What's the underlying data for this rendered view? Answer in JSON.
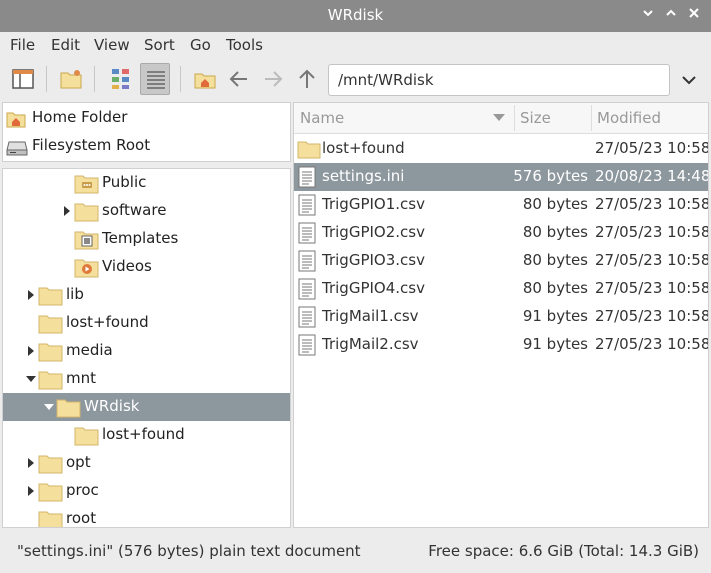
{
  "window": {
    "title": "WRdisk"
  },
  "menu": [
    "File",
    "Edit",
    "View",
    "Sort",
    "Go",
    "Tools"
  ],
  "toolbar": {
    "path": "/mnt/WRdisk"
  },
  "places": [
    {
      "label": "Home Folder",
      "icon": "home-icon"
    },
    {
      "label": "Filesystem Root",
      "icon": "drive-icon"
    }
  ],
  "tree": [
    {
      "label": "Public",
      "icon": "folder-public-icon",
      "expander": "none"
    },
    {
      "label": "software",
      "icon": "folder-icon",
      "expander": "collapsed"
    },
    {
      "label": "Templates",
      "icon": "folder-templates-icon",
      "expander": "none"
    },
    {
      "label": "Videos",
      "icon": "folder-videos-icon",
      "expander": "none"
    },
    {
      "label": "lib",
      "icon": "folder-icon",
      "expander": "collapsed"
    },
    {
      "label": "lost+found",
      "icon": "folder-icon",
      "expander": "none"
    },
    {
      "label": "media",
      "icon": "folder-icon",
      "expander": "collapsed"
    },
    {
      "label": "mnt",
      "icon": "folder-icon",
      "expander": "expanded"
    },
    {
      "label": "WRdisk",
      "icon": "folder-icon",
      "expander": "expanded",
      "selected": true
    },
    {
      "label": "lost+found",
      "icon": "folder-icon",
      "expander": "none"
    },
    {
      "label": "opt",
      "icon": "folder-icon",
      "expander": "collapsed"
    },
    {
      "label": "proc",
      "icon": "folder-icon",
      "expander": "collapsed"
    },
    {
      "label": "root",
      "icon": "folder-icon",
      "expander": "none"
    }
  ],
  "columns": {
    "name": "Name",
    "size": "Size",
    "modified": "Modified"
  },
  "files": [
    {
      "name": "lost+found",
      "size": "",
      "modified": "27/05/23 10:58",
      "icon": "folder-icon"
    },
    {
      "name": "settings.ini",
      "size": "576 bytes",
      "modified": "20/08/23 14:48",
      "icon": "text-file-icon",
      "selected": true
    },
    {
      "name": "TrigGPIO1.csv",
      "size": "80 bytes",
      "modified": "27/05/23 10:58",
      "icon": "text-file-icon"
    },
    {
      "name": "TrigGPIO2.csv",
      "size": "80 bytes",
      "modified": "27/05/23 10:58",
      "icon": "text-file-icon"
    },
    {
      "name": "TrigGPIO3.csv",
      "size": "80 bytes",
      "modified": "27/05/23 10:58",
      "icon": "text-file-icon"
    },
    {
      "name": "TrigGPIO4.csv",
      "size": "80 bytes",
      "modified": "27/05/23 10:58",
      "icon": "text-file-icon"
    },
    {
      "name": "TrigMail1.csv",
      "size": "91 bytes",
      "modified": "27/05/23 10:58",
      "icon": "text-file-icon"
    },
    {
      "name": "TrigMail2.csv",
      "size": "91 bytes",
      "modified": "27/05/23 10:58",
      "icon": "text-file-icon"
    }
  ],
  "status": {
    "left": "\"settings.ini\" (576 bytes) plain text document",
    "right": "Free space: 6.6 GiB (Total: 14.3 GiB)"
  },
  "colors": {
    "titlebar": "#8a8a8a",
    "selection": "#8d979e",
    "folder": "#f5df9c"
  }
}
